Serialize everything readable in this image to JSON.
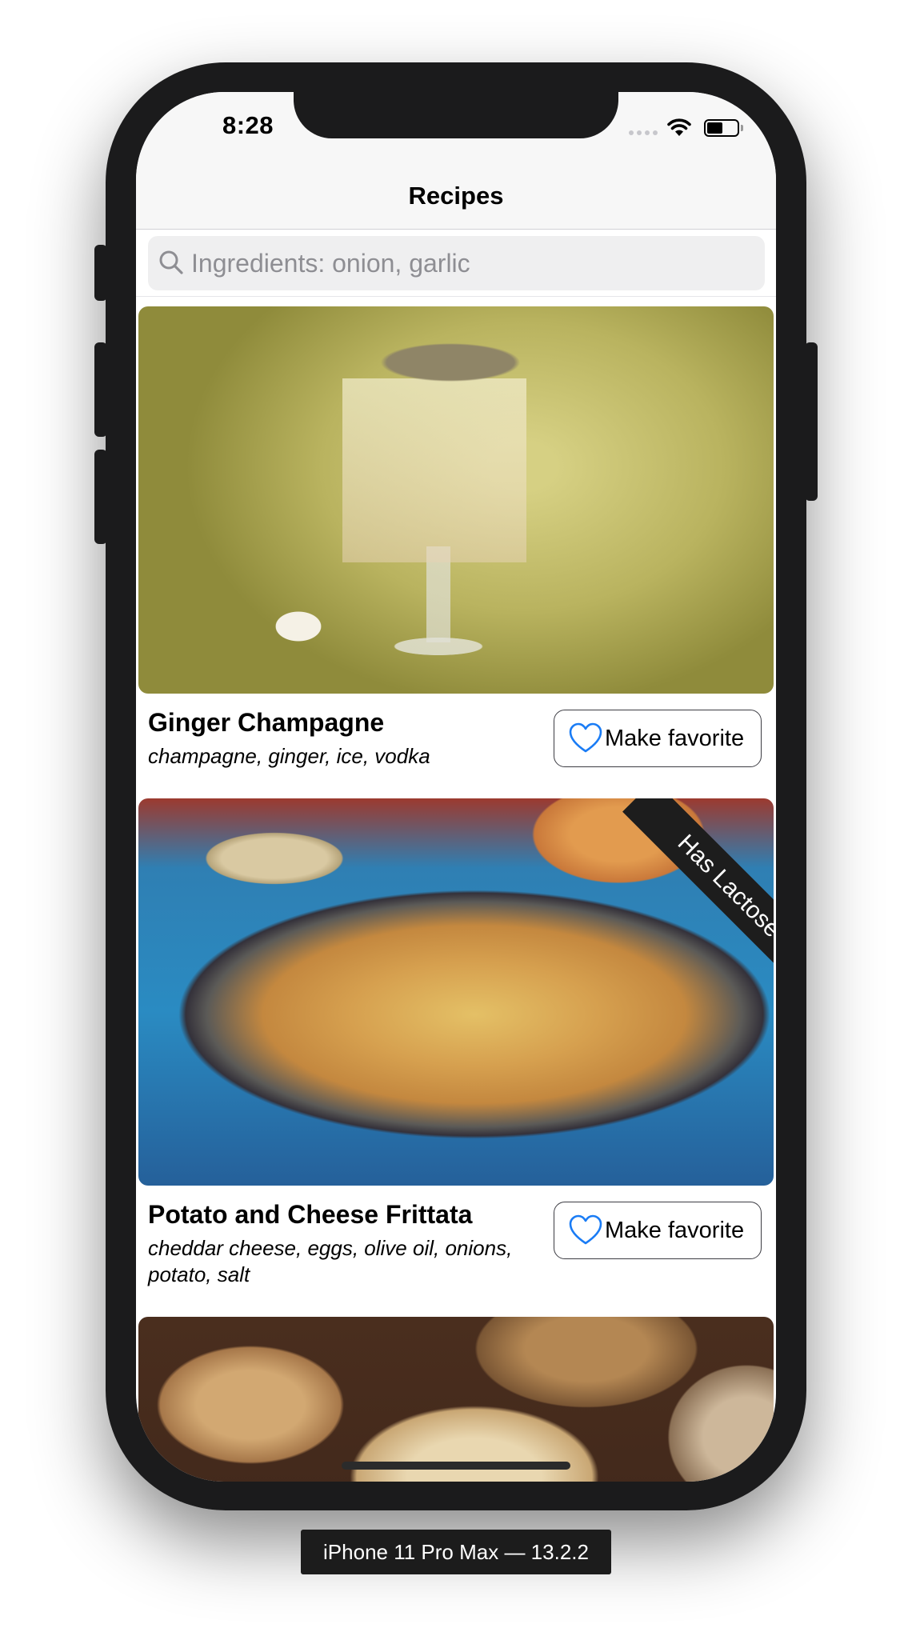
{
  "status_bar": {
    "time": "8:28"
  },
  "navbar": {
    "title": "Recipes"
  },
  "search": {
    "placeholder": "Ingredients: onion, garlic",
    "value": ""
  },
  "recipes": [
    {
      "title": "Ginger Champagne",
      "ingredients": "champagne, ginger, ice, vodka",
      "favorite_label": "Make favorite",
      "badge": ""
    },
    {
      "title": "Potato and Cheese Frittata",
      "ingredients": "cheddar cheese, eggs, olive oil, onions, potato, salt",
      "favorite_label": "Make favorite",
      "badge": "Has Lactose"
    }
  ],
  "device": {
    "label": "iPhone 11 Pro Max — 13.2.2"
  },
  "colors": {
    "accent": "#1a7cf5",
    "ribbon": "#1d1d1d",
    "device_frame": "#1b1b1c"
  }
}
